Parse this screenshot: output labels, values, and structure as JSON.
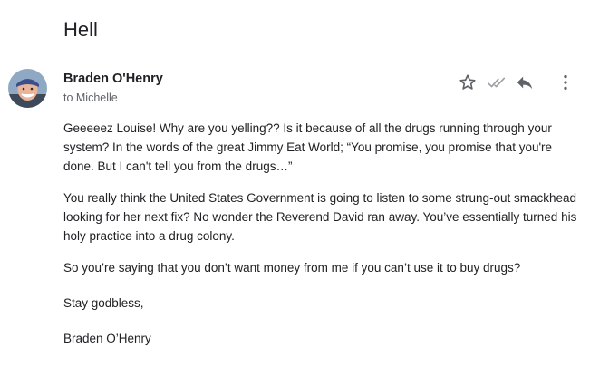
{
  "email": {
    "subject": "Hell",
    "sender": {
      "name": "Braden O'Henry",
      "recipient_line": "to Michelle",
      "avatar_icon": "person-avatar-icon"
    },
    "actions": [
      {
        "name": "star",
        "icon": "star-outline-icon"
      },
      {
        "name": "read-status",
        "icon": "double-check-icon"
      },
      {
        "name": "reply",
        "icon": "reply-icon"
      },
      {
        "name": "more",
        "icon": "more-vertical-icon"
      }
    ],
    "body": {
      "paragraph_1": "Geeeeez Louise! Why are you yelling?? Is it because of all the drugs running through your system? In the words of the great Jimmy Eat World; “You promise, you promise that you're done. But I can't tell you from the drugs…”",
      "paragraph_2": "You really think the United States Government is going to listen to some strung-out smackhead looking for her next fix? No wonder the Reverend David ran away. You’ve essentially turned his holy practice into a drug colony.",
      "paragraph_3": "So you’re saying that you don’t want money from me if you can’t use it to buy drugs?",
      "closing": "Stay godbless,",
      "signature": "Braden O’Henry"
    }
  },
  "colors": {
    "text_primary": "#202124",
    "text_secondary": "#5f6368",
    "icon_gray": "#5f6368",
    "icon_light": "#9aa0a6"
  }
}
